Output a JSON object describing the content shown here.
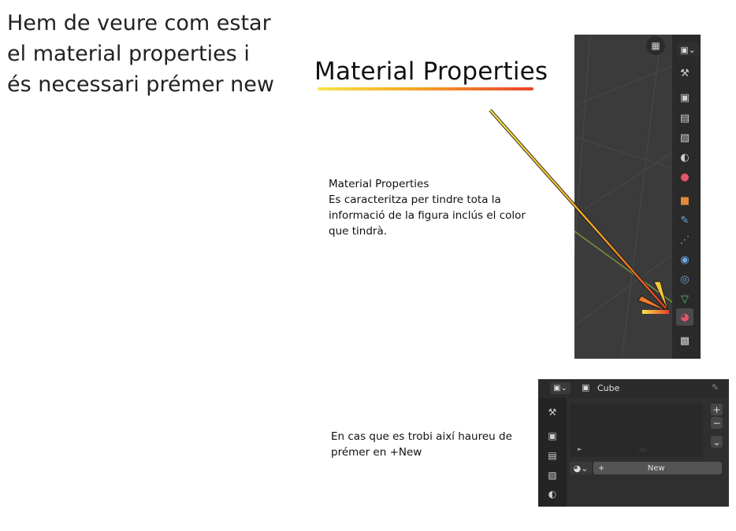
{
  "intro": {
    "lines": [
      "Hem de veure com estar",
      "el material properties i",
      "és necessari prémer new"
    ]
  },
  "heading": {
    "title": "Material Properties"
  },
  "note": {
    "lines": [
      "Material Properties",
      "Es caracteritza per tindre tota la",
      "informació de la figura inclús el color",
      "que tindrà."
    ]
  },
  "note2": {
    "lines": [
      "En cas que es trobi així haureu de",
      "prémer en +New"
    ]
  },
  "colors": {
    "gradient_start": "#f7e34a",
    "gradient_mid": "#f5a623",
    "gradient_end": "#e9412c",
    "blender_dark": "#2a2a2a",
    "material_tab": "#e4536c"
  },
  "shot1": {
    "tabs": [
      {
        "name": "tool-tab-icon",
        "glyph": "⚒"
      },
      {
        "name": "render-tab-icon",
        "glyph": "▣"
      },
      {
        "name": "output-tab-icon",
        "glyph": "▤"
      },
      {
        "name": "view-layer-tab-icon",
        "glyph": "▧"
      },
      {
        "name": "scene-tab-icon",
        "glyph": "◐"
      },
      {
        "name": "world-tab-icon",
        "glyph": "●"
      },
      {
        "name": "object-tab-icon",
        "glyph": "■"
      },
      {
        "name": "modifier-tab-icon",
        "glyph": "✎"
      },
      {
        "name": "particles-tab-icon",
        "glyph": "⋰"
      },
      {
        "name": "physics-tab-icon",
        "glyph": "◉"
      },
      {
        "name": "constraints-tab-icon",
        "glyph": "◎"
      },
      {
        "name": "data-tab-icon",
        "glyph": "▽"
      },
      {
        "name": "material-tab-icon",
        "glyph": "◕"
      },
      {
        "name": "texture-tab-icon",
        "glyph": "▩"
      }
    ]
  },
  "shot2": {
    "object_name": "Cube",
    "new_button": "New",
    "plus": "+",
    "minus": "−",
    "side_tabs": [
      {
        "name": "tool-tab-icon",
        "glyph": "⚒"
      },
      {
        "name": "render-tab-icon",
        "glyph": "▣"
      },
      {
        "name": "output-tab-icon",
        "glyph": "▤"
      },
      {
        "name": "view-layer-tab-icon",
        "glyph": "▧"
      },
      {
        "name": "scene-tab-icon",
        "glyph": "◐"
      }
    ]
  }
}
